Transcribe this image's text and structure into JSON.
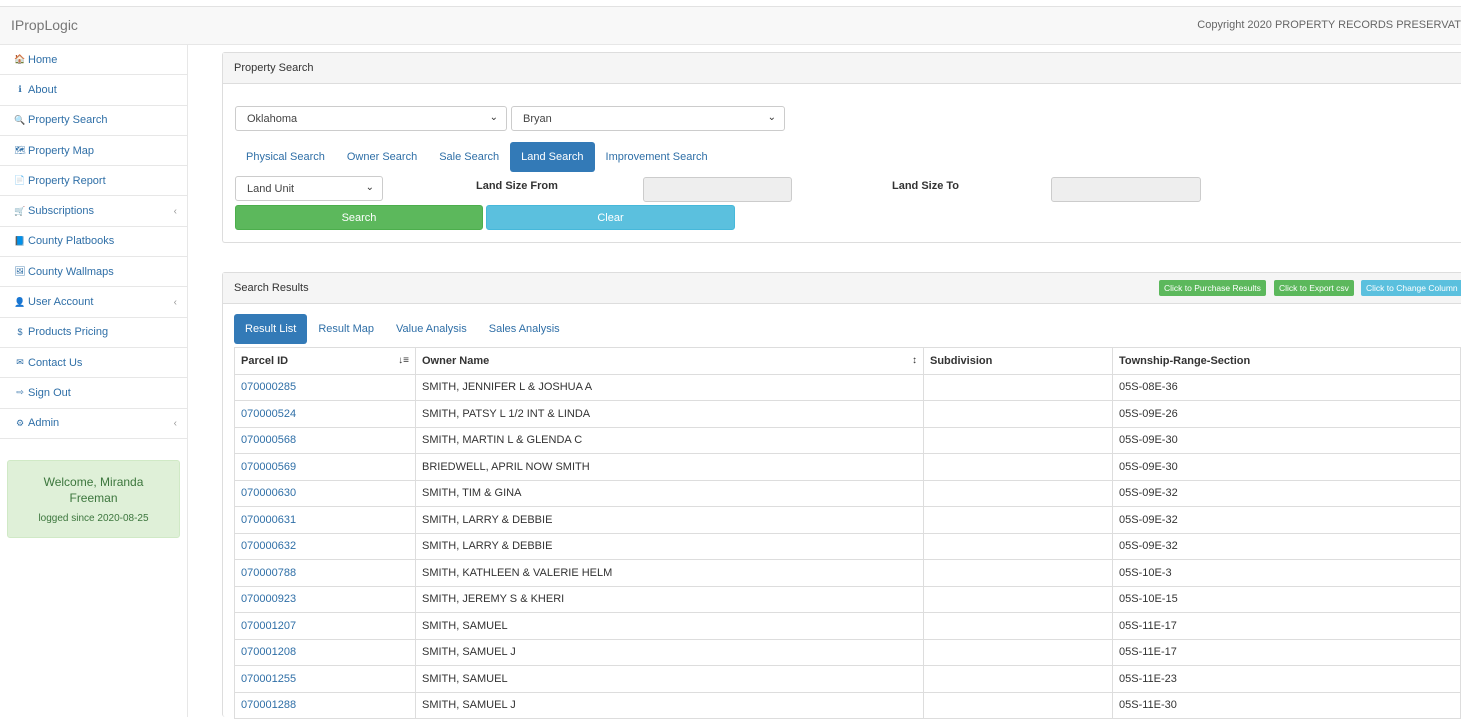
{
  "header": {
    "brand": "IPropLogic",
    "copyright": "Copyright 2020 PROPERTY RECORDS PRESERVAT"
  },
  "sidebar": {
    "items": [
      {
        "label": "Home",
        "icon": "home-icon",
        "glyph": "🏠"
      },
      {
        "label": "About",
        "icon": "info-icon",
        "glyph": "ℹ"
      },
      {
        "label": "Property Search",
        "icon": "search-icon",
        "glyph": "🔍"
      },
      {
        "label": "Property Map",
        "icon": "map-icon",
        "glyph": "🗺"
      },
      {
        "label": "Property Report",
        "icon": "file-icon",
        "glyph": "📄"
      },
      {
        "label": "Subscriptions",
        "icon": "cart-icon",
        "glyph": "🛒",
        "caret": "‹"
      },
      {
        "label": "County Platbooks",
        "icon": "book-icon",
        "glyph": "📘"
      },
      {
        "label": "County Wallmaps",
        "icon": "picture-icon",
        "glyph": "🖼"
      },
      {
        "label": "User Account",
        "icon": "user-icon",
        "glyph": "👤",
        "caret": "‹"
      },
      {
        "label": "Products Pricing",
        "icon": "dollar-icon",
        "glyph": "$"
      },
      {
        "label": "Contact Us",
        "icon": "envelope-icon",
        "glyph": "✉"
      },
      {
        "label": "Sign Out",
        "icon": "sign-out-icon",
        "glyph": "⇨"
      },
      {
        "label": "Admin",
        "icon": "gear-icon",
        "glyph": "⚙",
        "caret": "‹"
      }
    ],
    "welcome": {
      "name": "Welcome, Miranda Freeman",
      "since": "logged since 2020-08-25"
    }
  },
  "search_panel": {
    "title": "Property Search",
    "state": "Oklahoma",
    "county": "Bryan",
    "tabs": [
      "Physical Search",
      "Owner Search",
      "Sale Search",
      "Land Search",
      "Improvement Search"
    ],
    "active_tab": "Land Search",
    "unit": "Land Unit",
    "size_from_label": "Land Size From",
    "size_to_label": "Land Size To",
    "size_from_value": "",
    "size_to_value": "",
    "search_label": "Search",
    "clear_label": "Clear"
  },
  "results_panel": {
    "title": "Search Results",
    "purchase_label": "Click to Purchase Results",
    "export_label": "Click to Export csv",
    "columns_label": "Click to Change Column",
    "tabs": [
      "Result List",
      "Result Map",
      "Value Analysis",
      "Sales Analysis"
    ],
    "active_tab": "Result List",
    "headers": [
      "Parcel ID",
      "Owner Name",
      "Subdivision",
      "Township-Range-Section"
    ],
    "rows": [
      [
        "070000285",
        "SMITH, JENNIFER L & JOSHUA A",
        "",
        "05S-08E-36"
      ],
      [
        "070000524",
        "SMITH, PATSY L 1/2 INT & LINDA",
        "",
        "05S-09E-26"
      ],
      [
        "070000568",
        "SMITH, MARTIN L & GLENDA C",
        "",
        "05S-09E-30"
      ],
      [
        "070000569",
        "BRIEDWELL, APRIL NOW SMITH",
        "",
        "05S-09E-30"
      ],
      [
        "070000630",
        "SMITH, TIM & GINA",
        "",
        "05S-09E-32"
      ],
      [
        "070000631",
        "SMITH, LARRY & DEBBIE",
        "",
        "05S-09E-32"
      ],
      [
        "070000632",
        "SMITH, LARRY & DEBBIE",
        "",
        "05S-09E-32"
      ],
      [
        "070000788",
        "SMITH, KATHLEEN & VALERIE HELM",
        "",
        "05S-10E-3"
      ],
      [
        "070000923",
        "SMITH, JEREMY S & KHERI",
        "",
        "05S-10E-15"
      ],
      [
        "070001207",
        "SMITH, SAMUEL",
        "",
        "05S-11E-17"
      ],
      [
        "070001208",
        "SMITH, SAMUEL J",
        "",
        "05S-11E-17"
      ],
      [
        "070001255",
        "SMITH, SAMUEL",
        "",
        "05S-11E-23"
      ],
      [
        "070001288",
        "SMITH, SAMUEL J",
        "",
        "05S-11E-30"
      ]
    ]
  },
  "colors": {
    "link": "#2f6fa7",
    "primary": "#337ab7",
    "success": "#5cb85c",
    "info": "#5bc0de",
    "welcome_bg": "#dff0d8"
  }
}
